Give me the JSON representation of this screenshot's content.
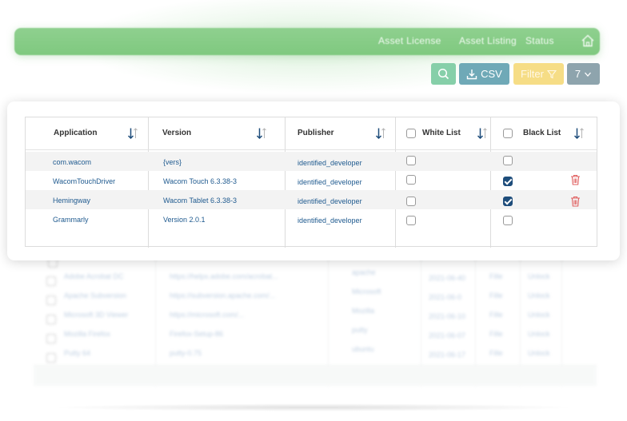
{
  "nav": {
    "asset_license": "Asset License",
    "asset_listing": "Asset Listing",
    "status": "Status"
  },
  "toolbar": {
    "csv_label": "CSV",
    "filter_label": "Filter",
    "page_size": "7"
  },
  "table": {
    "columns": [
      "Application",
      "Version",
      "Publisher",
      "White List",
      "Black List"
    ],
    "rows": [
      {
        "application": "com.wacom",
        "version": "{vers}",
        "publisher": "identified_developer",
        "white_list": false,
        "black_list": false,
        "delete": false
      },
      {
        "application": "WacomTouchDriver",
        "version": "Wacom Touch 6.3.38-3",
        "publisher": "identified_developer",
        "white_list": false,
        "black_list": true,
        "delete": true
      },
      {
        "application": "Hemingway",
        "version": "Wacom Tablet 6.3.38-3",
        "publisher": "identified_developer",
        "white_list": false,
        "black_list": true,
        "delete": true
      },
      {
        "application": "Grammarly",
        "version": "Version 2.0.1",
        "publisher": "identified_developer",
        "white_list": false,
        "black_list": false,
        "delete": false
      }
    ]
  },
  "background_table": {
    "rows": [
      {
        "name": "Adobe Acrobat DC",
        "link": "https://helpx.adobe.com/acrobat...",
        "vendor": "apache",
        "date": "2021-06-40",
        "type": "Fille",
        "status": "Unlock"
      },
      {
        "name": "Apache Subversion",
        "link": "https://subversion.apache.com/...",
        "vendor": "Microsoft",
        "date": "2021-06-0",
        "type": "Fille",
        "status": "Unlock"
      },
      {
        "name": "Microsoft 3D Viewer",
        "link": "https://microsoft.com/...",
        "vendor": "Mozilla",
        "date": "2021-06-10",
        "type": "Fille",
        "status": "Unlock"
      },
      {
        "name": "Mozilla Firefox",
        "link": "Firefox-Setup-86",
        "vendor": "putty",
        "date": "2021-06-07",
        "type": "Fille",
        "status": "Unlock"
      },
      {
        "name": "Putty 64",
        "link": "putty-0.75",
        "vendor": "ubuntu",
        "date": "2021-06-17",
        "type": "Fille",
        "status": "Unlock"
      }
    ]
  },
  "colors": {
    "nav_green": "#7fc97f",
    "search_btn": "#86cfa9",
    "csv_btn": "#6fa9b7",
    "filter_btn": "#f6dd86",
    "page_btn": "#8ea4ad",
    "link_blue": "#1f5a8f",
    "checked_blue": "#1e4d7b",
    "trash_red": "#e06060"
  }
}
